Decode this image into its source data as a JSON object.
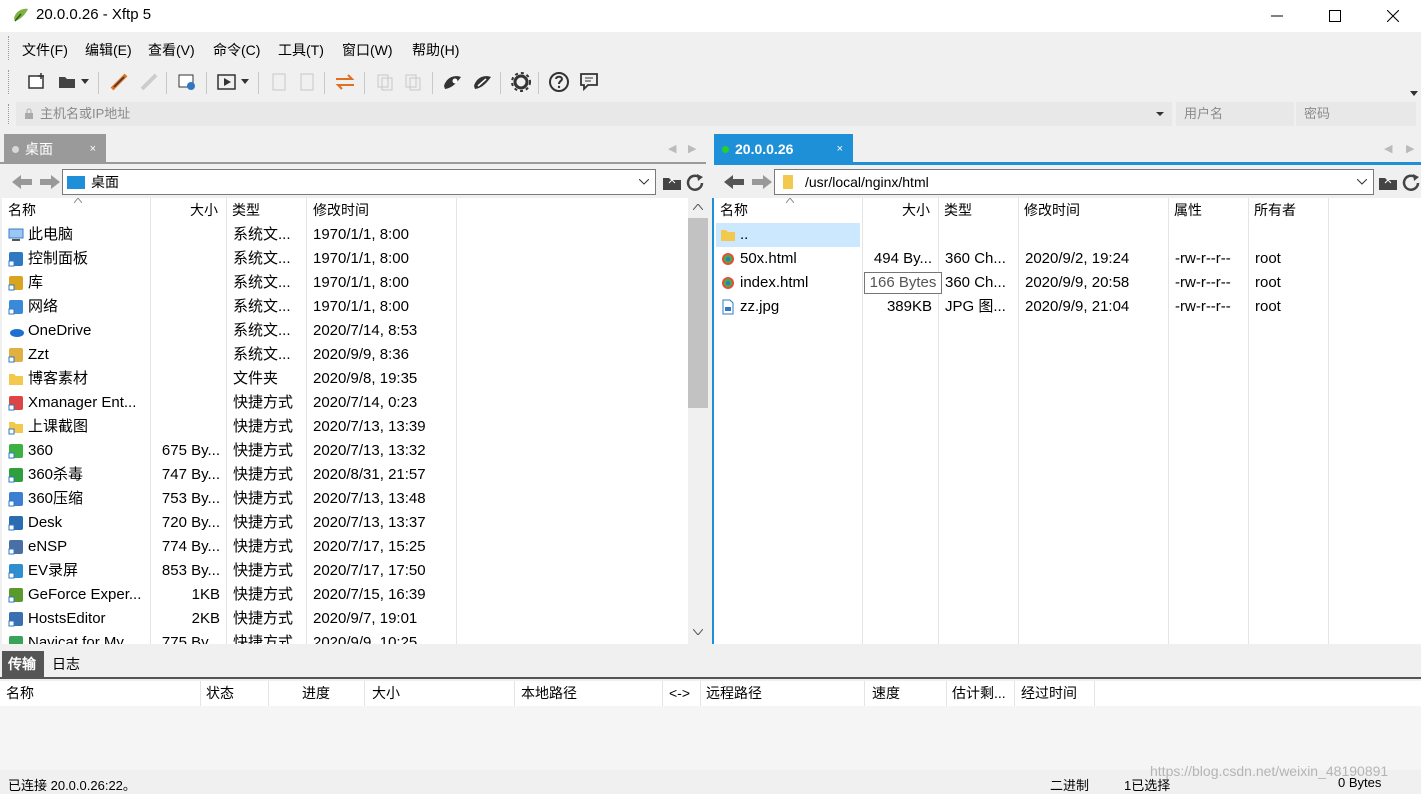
{
  "window": {
    "title": "20.0.0.26   - Xftp 5"
  },
  "menu": [
    "文件(F)",
    "编辑(E)",
    "查看(V)",
    "命令(C)",
    "工具(T)",
    "窗口(W)",
    "帮助(H)"
  ],
  "address": {
    "host_placeholder": "主机名或IP地址",
    "user_placeholder": "用户名",
    "password_placeholder": "密码"
  },
  "left": {
    "tab_label": "桌面",
    "path": "桌面",
    "columns": [
      "名称",
      "大小",
      "类型",
      "修改时间"
    ],
    "rows": [
      {
        "name": "此电脑",
        "size": "",
        "type": "系统文...",
        "mtime": "1970/1/1, 8:00",
        "icon": "computer-icon",
        "color": "#3a7bd5"
      },
      {
        "name": "控制面板",
        "size": "",
        "type": "系统文...",
        "mtime": "1970/1/1, 8:00",
        "icon": "control-panel-icon",
        "color": "#2f78c4"
      },
      {
        "name": "库",
        "size": "",
        "type": "系统文...",
        "mtime": "1970/1/1, 8:00",
        "icon": "library-icon",
        "color": "#d9a520"
      },
      {
        "name": "网络",
        "size": "",
        "type": "系统文...",
        "mtime": "1970/1/1, 8:00",
        "icon": "network-icon",
        "color": "#3b8ad9"
      },
      {
        "name": "OneDrive",
        "size": "",
        "type": "系统文...",
        "mtime": "2020/7/14, 8:53",
        "icon": "onedrive-icon",
        "color": "#1e6fd0"
      },
      {
        "name": "Zzt",
        "size": "",
        "type": "系统文...",
        "mtime": "2020/9/9, 8:36",
        "icon": "user-folder-icon",
        "color": "#e0b040"
      },
      {
        "name": "博客素材",
        "size": "",
        "type": "文件夹",
        "mtime": "2020/9/8, 19:35",
        "icon": "folder-icon",
        "color": "#f2c94c"
      },
      {
        "name": "Xmanager Ent...",
        "size": "",
        "type": "快捷方式",
        "mtime": "2020/7/14, 0:23",
        "icon": "shortcut-icon",
        "color": "#d44"
      },
      {
        "name": "上课截图",
        "size": "",
        "type": "快捷方式",
        "mtime": "2020/7/13, 13:39",
        "icon": "shortcut-folder-icon",
        "color": "#f2c94c"
      },
      {
        "name": "360",
        "size": "675 By...",
        "type": "快捷方式",
        "mtime": "2020/7/13, 13:32",
        "icon": "360-icon",
        "color": "#3cb043"
      },
      {
        "name": "360杀毒",
        "size": "747 By...",
        "type": "快捷方式",
        "mtime": "2020/8/31, 21:57",
        "icon": "360-antivirus-icon",
        "color": "#2e9e3f"
      },
      {
        "name": "360压缩",
        "size": "753 By...",
        "type": "快捷方式",
        "mtime": "2020/7/13, 13:48",
        "icon": "360-zip-icon",
        "color": "#3c7fd0"
      },
      {
        "name": "Desk",
        "size": "720 By...",
        "type": "快捷方式",
        "mtime": "2020/7/13, 13:37",
        "icon": "desk-icon",
        "color": "#2b6cb0"
      },
      {
        "name": "eNSP",
        "size": "774 By...",
        "type": "快捷方式",
        "mtime": "2020/7/17, 15:25",
        "icon": "ensp-icon",
        "color": "#4a6fa5"
      },
      {
        "name": "EV录屏",
        "size": "853 By...",
        "type": "快捷方式",
        "mtime": "2020/7/17, 17:50",
        "icon": "ev-recorder-icon",
        "color": "#2f8fd0"
      },
      {
        "name": "GeForce Exper...",
        "size": "1KB",
        "type": "快捷方式",
        "mtime": "2020/7/15, 16:39",
        "icon": "geforce-icon",
        "color": "#5a9a2a"
      },
      {
        "name": "HostsEditor",
        "size": "2KB",
        "type": "快捷方式",
        "mtime": "2020/9/7, 19:01",
        "icon": "hosts-editor-icon",
        "color": "#3a6fb0"
      },
      {
        "name": "Navicat for My...",
        "size": "775 By...",
        "type": "快捷方式",
        "mtime": "2020/9/9, 10:25",
        "icon": "navicat-icon",
        "color": "#3aa35a"
      }
    ]
  },
  "right": {
    "tab_label": "20.0.0.26",
    "path": "/usr/local/nginx/html",
    "columns": [
      "名称",
      "大小",
      "类型",
      "修改时间",
      "属性",
      "所有者"
    ],
    "rows": [
      {
        "name": "..",
        "size": "",
        "type": "",
        "mtime": "",
        "attr": "",
        "owner": "",
        "icon": "folder-icon",
        "selected": true
      },
      {
        "name": "50x.html",
        "size": "494 By...",
        "type": "360 Ch...",
        "mtime": "2020/9/2, 19:24",
        "attr": "-rw-r--r--",
        "owner": "root",
        "icon": "html-file-icon"
      },
      {
        "name": "index.html",
        "size": "166 Bytes",
        "type": "360 Ch...",
        "mtime": "2020/9/9, 20:58",
        "attr": "-rw-r--r--",
        "owner": "root",
        "icon": "html-file-icon",
        "tooltip": true
      },
      {
        "name": "zz.jpg",
        "size": "389KB",
        "type": "JPG 图...",
        "mtime": "2020/9/9, 21:04",
        "attr": "-rw-r--r--",
        "owner": "root",
        "icon": "image-file-icon"
      }
    ]
  },
  "bottom": {
    "tabs": [
      "传输",
      "日志"
    ],
    "columns": [
      "名称",
      "状态",
      "进度",
      "大小",
      "本地路径",
      "<->",
      "远程路径",
      "速度",
      "估计剩...",
      "经过时间"
    ]
  },
  "status": {
    "left": "已连接 20.0.0.26:22。",
    "mode": "二进制",
    "selection": "1已选择",
    "size": "0 Bytes",
    "watermark": "https://blog.csdn.net/weixin_48190891"
  },
  "colors": {
    "accent": "#1e90d8",
    "selected_row": "#cce8ff",
    "tab_inactive": "#9a9a9a"
  }
}
